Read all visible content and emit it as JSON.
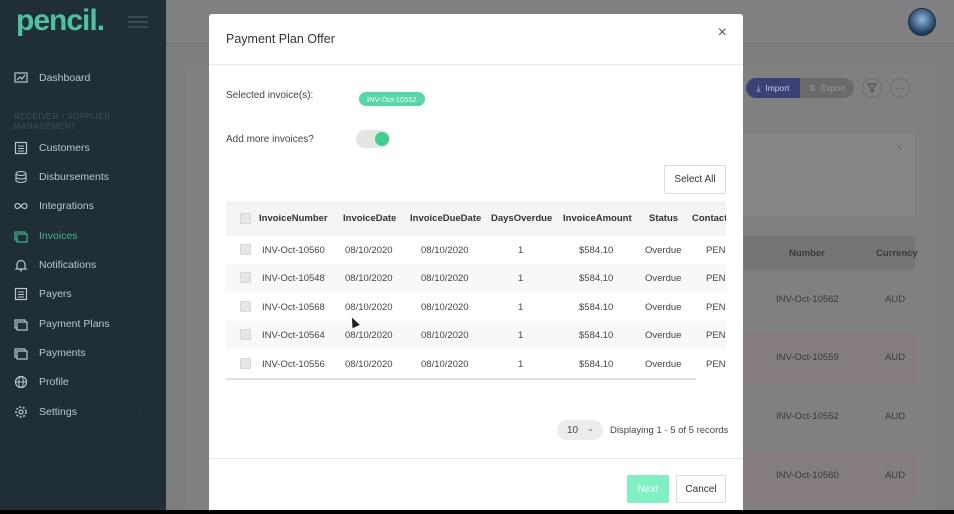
{
  "brand": {
    "logo": "pencil."
  },
  "sidebar": {
    "section_label": "RECEIVER / SUPPLIER MANAGEMENT",
    "items": [
      {
        "label": "Dashboard",
        "icon": "dashboard-icon"
      },
      {
        "label": "Customers",
        "icon": "list-icon"
      },
      {
        "label": "Disbursements",
        "icon": "coins-icon"
      },
      {
        "label": "Integrations",
        "icon": "infinity-icon"
      },
      {
        "label": "Invoices",
        "icon": "invoices-icon",
        "active": true
      },
      {
        "label": "Notifications",
        "icon": "bell-icon"
      },
      {
        "label": "Payers",
        "icon": "list-icon"
      },
      {
        "label": "Payment Plans",
        "icon": "stack-icon"
      },
      {
        "label": "Payments",
        "icon": "stack-icon"
      },
      {
        "label": "Profile",
        "icon": "globe-icon"
      },
      {
        "label": "Settings",
        "icon": "gear-icon"
      }
    ]
  },
  "background": {
    "import_label": "Import",
    "export_label": "Export",
    "table_headers": [
      "Number",
      "Currency"
    ],
    "rows": [
      {
        "number": "INV-Oct-10562",
        "currency": "AUD"
      },
      {
        "number": "INV-Oct-10559",
        "currency": "AUD"
      },
      {
        "number": "INV-Oct-10552",
        "currency": "AUD"
      },
      {
        "number": "INV-Oct-10560",
        "currency": "AUD"
      }
    ]
  },
  "modal": {
    "title": "Payment Plan Offer",
    "close_glyph": "×",
    "selected_label": "Selected invoice(s):",
    "selected_chip": "INV-Oct-10552",
    "add_more_label": "Add more invoices?",
    "add_more_on": true,
    "select_all_label": "Select All",
    "columns": [
      "InvoiceNumber",
      "InvoiceDate",
      "InvoiceDueDate",
      "DaysOverdue",
      "InvoiceAmount",
      "Status",
      "Contact"
    ],
    "rows": [
      [
        "INV-Oct-10560",
        "08/10/2020",
        "08/10/2020",
        "1",
        "$584.10",
        "Overdue",
        "PEN"
      ],
      [
        "INV-Oct-10548",
        "08/10/2020",
        "08/10/2020",
        "1",
        "$584.10",
        "Overdue",
        "PEN"
      ],
      [
        "INV-Oct-10568",
        "08/10/2020",
        "08/10/2020",
        "1",
        "$584.10",
        "Overdue",
        "PEN"
      ],
      [
        "INV-Oct-10564",
        "08/10/2020",
        "08/10/2020",
        "1",
        "$584.10",
        "Overdue",
        "PEN"
      ],
      [
        "INV-Oct-10556",
        "08/10/2020",
        "08/10/2020",
        "1",
        "$584.10",
        "Overdue",
        "PEN"
      ]
    ],
    "page_size": "10",
    "displaying_text": "Displaying 1 - 5 of 5 records",
    "next_label": "Next",
    "cancel_label": "Cancel"
  },
  "colors": {
    "sidebar_bg": "#1f2f35",
    "brand_green": "#4fc3a1",
    "chip_green": "#56d7a8",
    "next_button": "#7ef0c4",
    "import_button": "#3c4175"
  }
}
